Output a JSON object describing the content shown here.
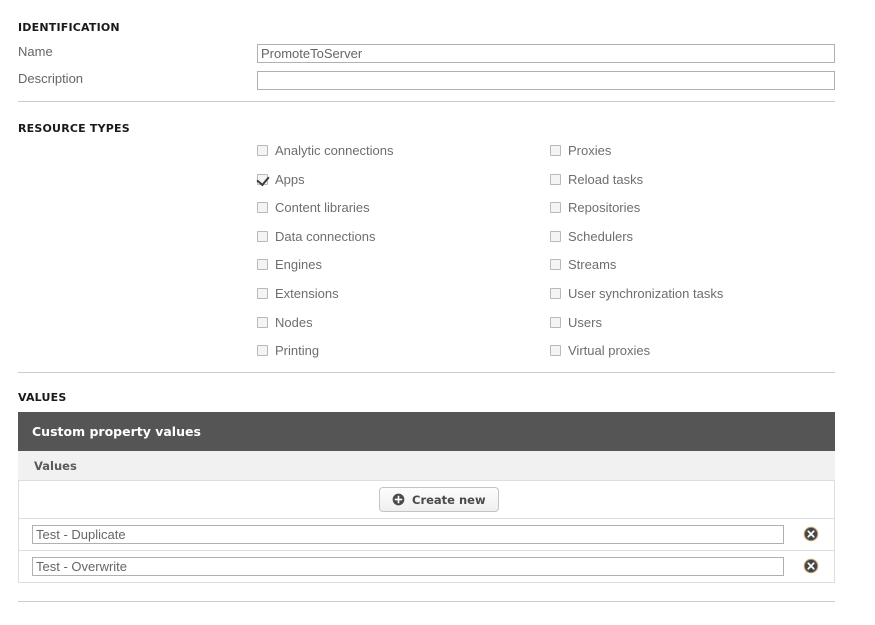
{
  "sections": {
    "identification": "IDENTIFICATION",
    "resource_types": "RESOURCE TYPES",
    "values": "VALUES"
  },
  "identification": {
    "name_label": "Name",
    "name_value": "PromoteToServer",
    "name_placeholder": "",
    "description_label": "Description",
    "description_value": "",
    "description_placeholder": ""
  },
  "resource_types": {
    "left_column": [
      {
        "label": "Analytic connections",
        "checked": false
      },
      {
        "label": "Apps",
        "checked": true
      },
      {
        "label": "Content libraries",
        "checked": false
      },
      {
        "label": "Data connections",
        "checked": false
      },
      {
        "label": "Engines",
        "checked": false
      },
      {
        "label": "Extensions",
        "checked": false
      },
      {
        "label": "Nodes",
        "checked": false
      },
      {
        "label": "Printing",
        "checked": false
      }
    ],
    "right_column": [
      {
        "label": "Proxies",
        "checked": false
      },
      {
        "label": "Reload tasks",
        "checked": false
      },
      {
        "label": "Repositories",
        "checked": false
      },
      {
        "label": "Schedulers",
        "checked": false
      },
      {
        "label": "Streams",
        "checked": false
      },
      {
        "label": "User synchronization tasks",
        "checked": false
      },
      {
        "label": "Users",
        "checked": false
      },
      {
        "label": "Virtual proxies",
        "checked": false
      }
    ]
  },
  "values_panel": {
    "header": "Custom property values",
    "column_header": "Values",
    "create_button": "Create new",
    "create_icon": "plus-circle-icon",
    "delete_icon": "delete-circle-icon",
    "rows": [
      {
        "value": "Test - Duplicate",
        "placeholder": ""
      },
      {
        "value": "Test - Overwrite",
        "placeholder": ""
      }
    ]
  },
  "colors": {
    "panel_header_bg": "#555555",
    "subheader_bg": "#f1f1f1",
    "divider": "#cccccc",
    "text": "#666666",
    "heading": "#1a1a1a",
    "delete_icon": "#4a4a4a"
  }
}
